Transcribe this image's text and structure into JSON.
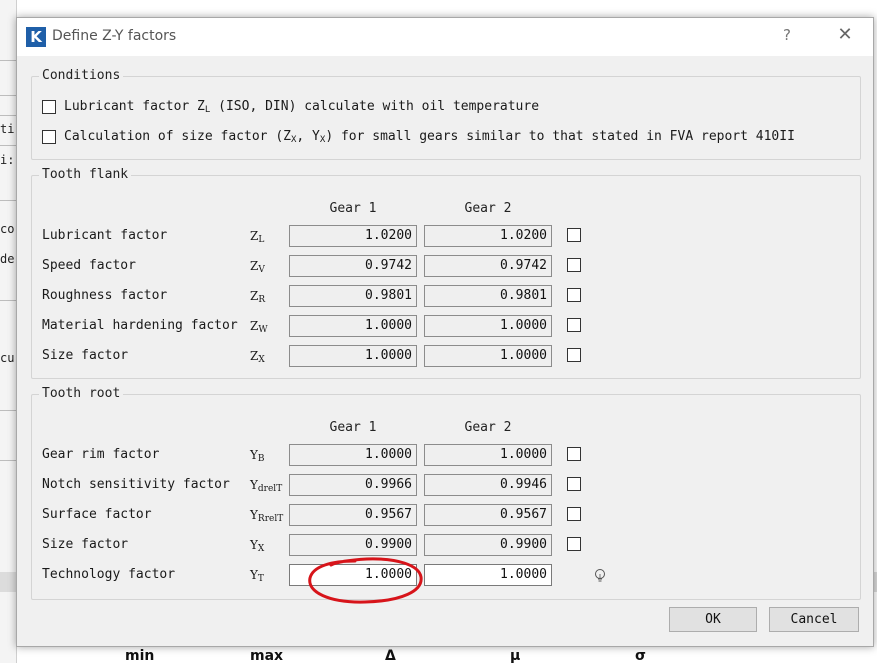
{
  "dialog": {
    "title": "Define Z-Y factors",
    "logo_letter": "K",
    "help_label": "?",
    "close_label": "✕"
  },
  "background_app": {
    "left_fragments": [
      "ti",
      "i:",
      "co",
      "de",
      "cu"
    ],
    "bottom_headers": [
      "min",
      "max",
      "Δ",
      "μ",
      "σ"
    ]
  },
  "conditions": {
    "title": "Conditions",
    "lubricant_checkbox": {
      "label_pre": "Lubricant factor Z",
      "label_sub": "L",
      "label_post": " (ISO, DIN) calculate with oil temperature",
      "checked": false
    },
    "size_checkbox": {
      "label_pre": "Calculation of size factor (Z",
      "label_sub1": "X",
      "label_mid": ", Y",
      "label_sub2": "X",
      "label_post": ") for small gears similar to that stated in FVA report 410II",
      "checked": false
    }
  },
  "tooth_flank": {
    "title": "Tooth flank",
    "col_gear1": "Gear 1",
    "col_gear2": "Gear 2",
    "rows": [
      {
        "label": "Lubricant factor",
        "sym": "Z",
        "sub": "L",
        "gear1": "1.0200",
        "gear2": "1.0200",
        "override": false
      },
      {
        "label": "Speed factor",
        "sym": "Z",
        "sub": "V",
        "gear1": "0.9742",
        "gear2": "0.9742",
        "override": false
      },
      {
        "label": "Roughness factor",
        "sym": "Z",
        "sub": "R",
        "gear1": "0.9801",
        "gear2": "0.9801",
        "override": false
      },
      {
        "label": "Material hardening factor",
        "sym": "Z",
        "sub": "W",
        "gear1": "1.0000",
        "gear2": "1.0000",
        "override": false
      },
      {
        "label": "Size factor",
        "sym": "Z",
        "sub": "X",
        "gear1": "1.0000",
        "gear2": "1.0000",
        "override": false
      }
    ]
  },
  "tooth_root": {
    "title": "Tooth root",
    "col_gear1": "Gear 1",
    "col_gear2": "Gear 2",
    "rows": [
      {
        "label": "Gear rim factor",
        "sym": "Y",
        "sub": "B",
        "gear1": "1.0000",
        "gear2": "1.0000",
        "override": false
      },
      {
        "label": "Notch sensitivity factor",
        "sym": "Y",
        "sub": "drelT",
        "gear1": "0.9966",
        "gear2": "0.9946",
        "override": false
      },
      {
        "label": "Surface factor",
        "sym": "Y",
        "sub": "RrelT",
        "gear1": "0.9567",
        "gear2": "0.9567",
        "override": false
      },
      {
        "label": "Size factor",
        "sym": "Y",
        "sub": "X",
        "gear1": "0.9900",
        "gear2": "0.9900",
        "override": false
      },
      {
        "label": "Technology factor",
        "sym": "Y",
        "sub": "T",
        "gear1": "1.0000",
        "gear2": "1.0000",
        "hint_icon": "lightbulb-icon"
      }
    ]
  },
  "buttons": {
    "ok": "OK",
    "cancel": "Cancel"
  },
  "colors": {
    "logo": "#1f5fa8",
    "annotation_circle": "#d7141a",
    "dialog_bg": "#f0f0f0"
  }
}
